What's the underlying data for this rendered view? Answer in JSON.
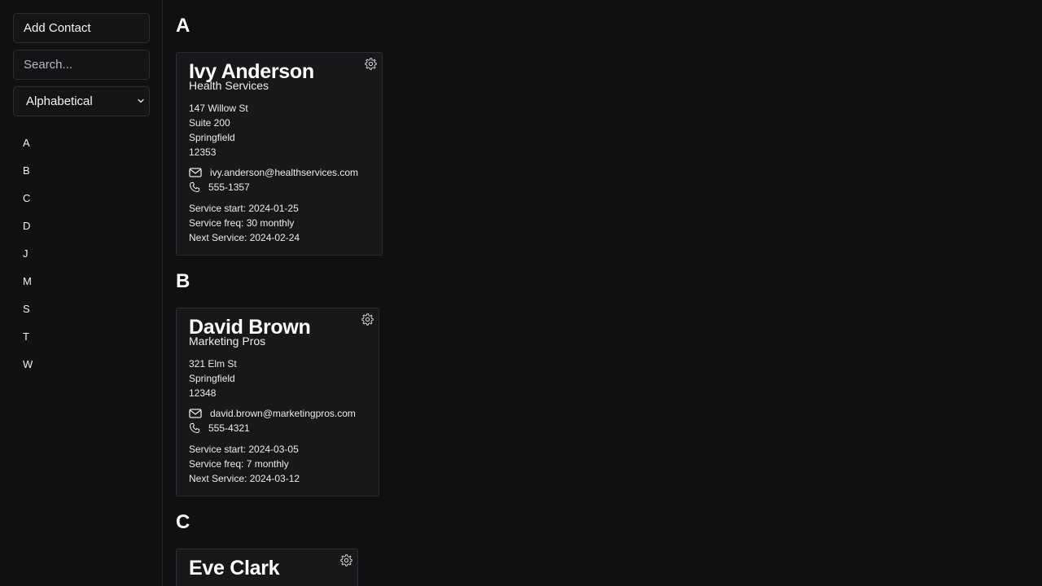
{
  "sidebar": {
    "add_button": "Add Contact",
    "search_placeholder": "Search...",
    "sort_value": "Alphabetical",
    "letters": [
      "A",
      "B",
      "C",
      "D",
      "J",
      "M",
      "S",
      "T",
      "W"
    ]
  },
  "sections": [
    {
      "letter": "A",
      "contacts": [
        {
          "name": "Ivy Anderson",
          "company": "Health Services",
          "address": [
            "147 Willow St",
            "Suite 200",
            "Springfield",
            "12353"
          ],
          "email": "ivy.anderson@healthservices.com",
          "phone": "555-1357",
          "service_start": "Service start: 2024-01-25",
          "service_freq": "Service freq: 30 monthly",
          "next_service": "Next Service: 2024-02-24"
        }
      ]
    },
    {
      "letter": "B",
      "contacts": [
        {
          "name": "David Brown",
          "company": "Marketing Pros",
          "address": [
            "321 Elm St",
            "Springfield",
            "12348"
          ],
          "email": "david.brown@marketingpros.com",
          "phone": "555-4321",
          "service_start": "Service start: 2024-03-05",
          "service_freq": "Service freq: 7 monthly",
          "next_service": "Next Service: 2024-03-12"
        }
      ]
    },
    {
      "letter": "C",
      "contacts": [
        {
          "name": "Eve Clark"
        }
      ]
    }
  ],
  "icons": {
    "gear": "gear-icon",
    "mail": "mail-icon",
    "phone": "phone-icon",
    "chevron": "chevron-down-icon"
  },
  "colors": {
    "background": "#101011",
    "card": "#18181b",
    "border": "#2d2d31",
    "text": "#f2f2f2"
  }
}
